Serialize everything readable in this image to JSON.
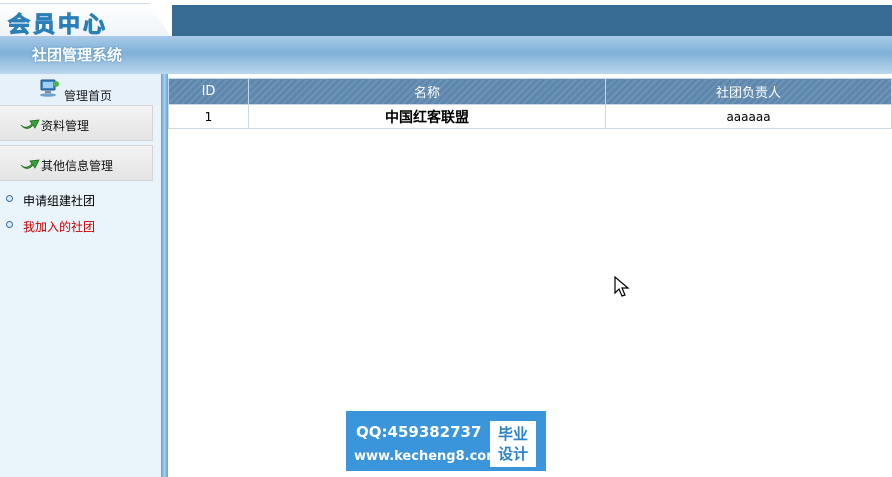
{
  "header": {
    "logo_text": "会员中心",
    "system_title": "社团管理系统"
  },
  "sidebar": {
    "home_label": "管理首页",
    "menu": [
      {
        "label": "资料管理"
      },
      {
        "label": "其他信息管理"
      }
    ],
    "links": [
      {
        "label": "申请组建社团",
        "color": "#000000"
      },
      {
        "label": "我加入的社团",
        "color": "#cc0000"
      }
    ]
  },
  "table": {
    "columns": [
      "ID",
      "名称",
      "社团负责人"
    ],
    "rows": [
      {
        "id": "1",
        "name": "中国红客联盟",
        "leader": "aaaaaa"
      }
    ]
  },
  "watermark": {
    "qq": "QQ:459382737",
    "url": "www.kecheng8.com",
    "badge_line1": "毕业",
    "badge_line2": "设计"
  },
  "colors": {
    "header_dark": "#386b93",
    "table_header": "#5d87ad",
    "link_active": "#cc0000"
  }
}
